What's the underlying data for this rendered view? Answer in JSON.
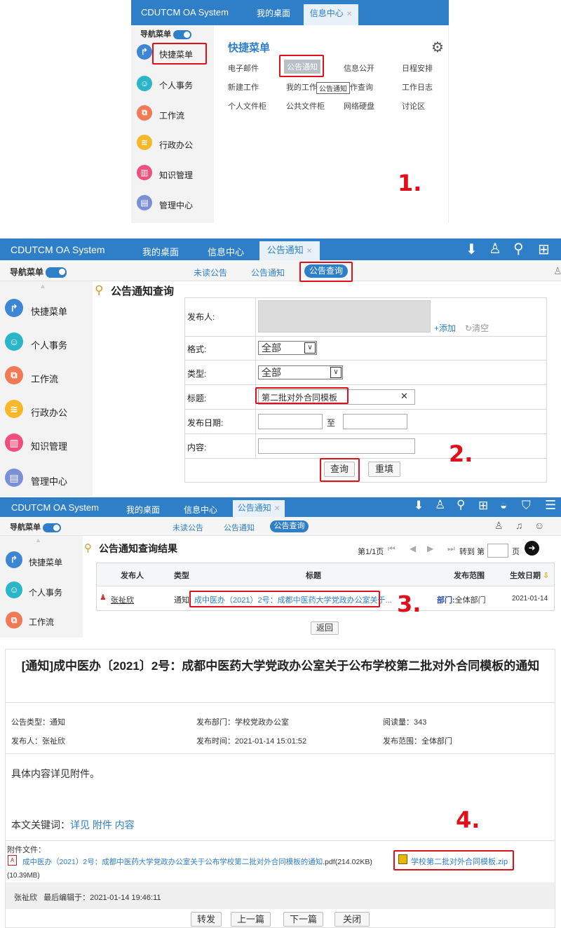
{
  "p1": {
    "app_title": "CDUTCM OA System",
    "tabs": [
      {
        "label": "我的桌面"
      },
      {
        "label": "信息中心"
      }
    ],
    "tab_close": "✕",
    "nav_toggle": "导航菜单",
    "sidebar": [
      "快捷菜单",
      "个人事务",
      "工作流",
      "行政办公",
      "知识管理",
      "管理中心"
    ],
    "panel_title": "快捷菜单",
    "quick_links": [
      "电子邮件",
      "公告通知",
      "信息公开",
      "日程安排",
      "新建工作",
      "我的工作",
      "作查询",
      "工作日志",
      "个人文件柜",
      "公共文件柜",
      "网络硬盘",
      "讨论区"
    ],
    "tooltip": "公告通知",
    "step": "1."
  },
  "p2": {
    "app_title": "CDUTCM OA System",
    "tabs": [
      {
        "label": "我的桌面"
      },
      {
        "label": "信息中心"
      },
      {
        "label": "公告通知"
      }
    ],
    "nav_toggle": "导航菜单",
    "subtabs": [
      "未读公告",
      "公告通知",
      "公告查询"
    ],
    "sidebar": [
      "快捷菜单",
      "个人事务",
      "工作流",
      "行政办公",
      "知识管理",
      "管理中心"
    ],
    "page_title": "公告通知查询",
    "form": {
      "publisher_label": "发布人:",
      "add_link": "添加",
      "clear_link": "清空",
      "format_label": "格式:",
      "format_value": "全部",
      "type_label": "类型:",
      "type_value": "全部",
      "title_label": "标题:",
      "title_value": "第二批对外合同模板",
      "date_label": "发布日期:",
      "date_to": "至",
      "content_label": "内容:",
      "query_btn": "查询",
      "reset_btn": "重填"
    },
    "step": "2."
  },
  "p3": {
    "app_title": "CDUTCM OA System",
    "tabs": [
      {
        "label": "我的桌面"
      },
      {
        "label": "信息中心"
      },
      {
        "label": "公告通知"
      }
    ],
    "nav_toggle": "导航菜单",
    "subtabs": [
      "未读公告",
      "公告通知",
      "公告查询"
    ],
    "sidebar": [
      "快捷菜单",
      "个人事务",
      "工作流"
    ],
    "page_title": "公告通知查询结果",
    "pager": {
      "page": "第1/1页",
      "goto": "转到 第",
      "unit": "页"
    },
    "columns": [
      "发布人",
      "类型",
      "标题",
      "发布范围",
      "生效日期"
    ],
    "row": {
      "publisher": "张祉欣",
      "type": "通知",
      "title": "成中医办（2021）2号：成都中医药大学党政办公室关于...",
      "scope_dept": "部门:",
      "scope": "全体部门",
      "date": "2021-01-14"
    },
    "back_btn": "返回",
    "step": "3."
  },
  "p4": {
    "title": "[通知]成中医办〔2021〕2号：成都中医药大学党政办公室关于公布学校第二批对外合同模板的通知",
    "meta": {
      "type": "公告类型：通知",
      "dept": "发布部门：学校党政办公室",
      "reads": "阅读量：343",
      "publisher": "发布人：张祉欣",
      "time": "发布时间：2021-01-14 15:01:52",
      "scope": "发布范围：全体部门"
    },
    "body": "具体内容详见附件。",
    "keywords_label": "本文关键词：",
    "keywords": "详见 附件 内容",
    "attach_label": "附件文件：",
    "attach1": "成中医办（2021）2号：成都中医药大学党政办公室关于公布学校第二批对外合同模板的通知",
    "attach1_ext": ".pdf(214.02KB)",
    "attach1_size2": "(10.39MB)",
    "attach2": "学校第二批对外合同模板.zip",
    "footer": "张祉欣   最后编辑于：2021-01-14 19:46:11",
    "buttons": [
      "转发",
      "上一篇",
      "下一篇",
      "关闭"
    ],
    "step": "4."
  },
  "icon_colors": {
    "quick": "#3d86d6",
    "personal": "#2ab5c8",
    "workflow": "#f07a55",
    "admin": "#f6b72a",
    "knowledge": "#ef4f7a",
    "manage": "#7b8fd8"
  }
}
